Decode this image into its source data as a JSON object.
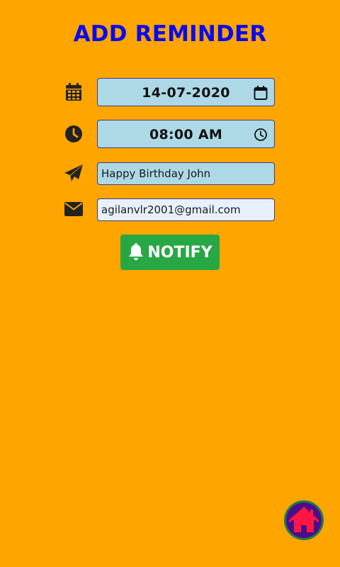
{
  "header": {
    "title": "ADD REMINDER"
  },
  "form": {
    "date": {
      "value": "14-07-2020",
      "icon": "calendar-icon",
      "picker_icon": "calendar-outline-icon"
    },
    "time": {
      "value": "08:00 AM",
      "icon": "clock-icon",
      "picker_icon": "clock-outline-icon"
    },
    "message": {
      "value": "Happy Birthday John",
      "icon": "paper-plane-icon"
    },
    "email": {
      "value": "agilanvlr2001@gmail.com",
      "icon": "envelope-icon"
    }
  },
  "actions": {
    "notify_label": "NOTIFY",
    "notify_icon": "bell-icon"
  },
  "fab": {
    "icon": "home-icon"
  },
  "colors": {
    "background": "#FFA500",
    "title": "#0A0AEE",
    "field_bg": "#ADD8E6",
    "email_bg": "#E8F0FE",
    "notify_button": "#28A745",
    "fab_bg": "#4B0E8A",
    "fab_border": "#1F7A4D",
    "fab_icon": "#FF1744"
  }
}
